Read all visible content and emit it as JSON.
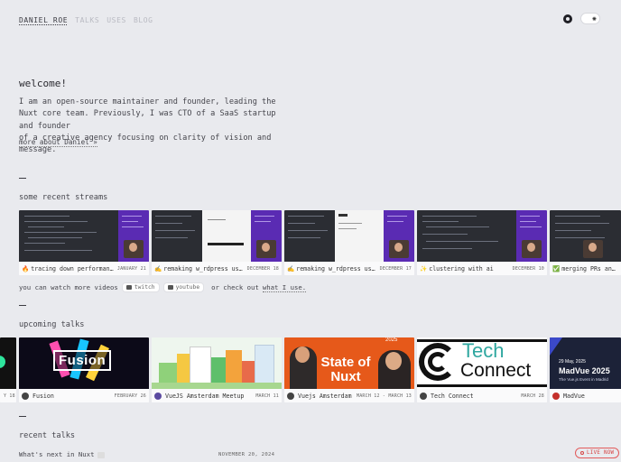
{
  "nav": {
    "brand": "DANIEL ROE",
    "links": [
      "TALKS",
      "USES",
      "BLOG"
    ]
  },
  "header": {
    "icons": [
      "github-icon",
      "sun-icon"
    ]
  },
  "intro": {
    "title": "welcome!",
    "lines": [
      "I am an open-source maintainer and founder, leading the",
      "Nuxt core team. Previously, I was CTO of a SaaS startup and founder",
      "of a creative agency focusing on clarity of vision and message."
    ],
    "more": "more about Daniel »"
  },
  "streams": {
    "heading": "some recent streams",
    "items": [
      {
        "emoji": "🔥",
        "title": "tracing down performance...",
        "date": "JANUARY 21"
      },
      {
        "emoji": "✍️",
        "title": "remaking w_rdpress using...",
        "date": "DECEMBER 18"
      },
      {
        "emoji": "✍️",
        "title": "remaking w_rdpress using...",
        "date": "DECEMBER 17"
      },
      {
        "emoji": "✨",
        "title": "clustering with ai",
        "date": "DECEMBER 10"
      },
      {
        "emoji": "✅",
        "title": "merging PRs and mak",
        "date": ""
      }
    ],
    "watch_prefix": "you can watch more videos",
    "twitch": "twitch",
    "youtube": "youtube",
    "watch_mid": "or check out",
    "watch_link": "what I use."
  },
  "talks": {
    "heading": "upcoming talks",
    "items": [
      {
        "title": "",
        "date": "Y 18",
        "thumb_text": ""
      },
      {
        "title": "Fusion",
        "date": "FEBRUARY 26",
        "thumb_text": "Fusion"
      },
      {
        "title": "VueJS Amsterdam Meetup",
        "date": "MARCH 11",
        "thumb_text": ""
      },
      {
        "title": "Vuejs Amsterdam",
        "date": "MARCH 12 - MARCH 13",
        "thumb_text": "State of Nuxt",
        "year": "2025"
      },
      {
        "title": "Tech Connect",
        "date": "MARCH 28",
        "thumb_text_1": "Tech",
        "thumb_text_2": "Connect"
      },
      {
        "title": "MadVue",
        "date": "",
        "thumb_date": "29 May, 2025",
        "thumb_title": "MadVue 2025",
        "thumb_sub": "The Vue.js Event in Madrid"
      }
    ]
  },
  "recent": {
    "heading": "recent talks",
    "first_title": "What's next in Nuxt",
    "first_date": "NOVEMBER 20, 2024",
    "live": "LIVE NOW"
  },
  "colors": {
    "bg": "#e9eaee",
    "accent_purple": "#5a2bb3",
    "live_red": "#d64343"
  }
}
